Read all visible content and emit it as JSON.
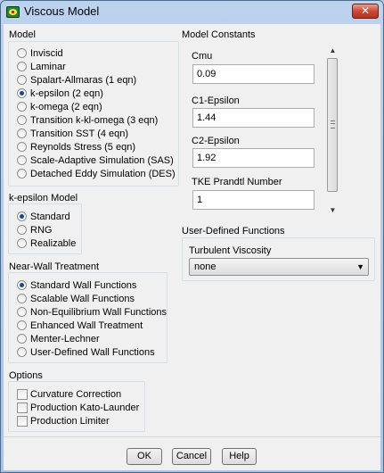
{
  "window": {
    "title": "Viscous Model",
    "close_glyph": "✕"
  },
  "model": {
    "label": "Model",
    "options": [
      {
        "label": "Inviscid",
        "selected": false
      },
      {
        "label": "Laminar",
        "selected": false
      },
      {
        "label": "Spalart-Allmaras (1 eqn)",
        "selected": false
      },
      {
        "label": "k-epsilon (2 eqn)",
        "selected": true
      },
      {
        "label": "k-omega (2 eqn)",
        "selected": false
      },
      {
        "label": "Transition k-kl-omega (3 eqn)",
        "selected": false
      },
      {
        "label": "Transition SST (4 eqn)",
        "selected": false
      },
      {
        "label": "Reynolds Stress (5 eqn)",
        "selected": false
      },
      {
        "label": "Scale-Adaptive Simulation (SAS)",
        "selected": false
      },
      {
        "label": "Detached Eddy Simulation (DES)",
        "selected": false
      }
    ]
  },
  "k_epsilon_model": {
    "label": "k-epsilon Model",
    "options": [
      {
        "label": "Standard",
        "selected": true
      },
      {
        "label": "RNG",
        "selected": false
      },
      {
        "label": "Realizable",
        "selected": false
      }
    ]
  },
  "near_wall": {
    "label": "Near-Wall Treatment",
    "options": [
      {
        "label": "Standard Wall Functions",
        "selected": true
      },
      {
        "label": "Scalable Wall Functions",
        "selected": false
      },
      {
        "label": "Non-Equilibrium Wall Functions",
        "selected": false
      },
      {
        "label": "Enhanced Wall Treatment",
        "selected": false
      },
      {
        "label": "Menter-Lechner",
        "selected": false
      },
      {
        "label": "User-Defined Wall Functions",
        "selected": false
      }
    ]
  },
  "options": {
    "label": "Options",
    "checkboxes": [
      {
        "label": "Curvature Correction",
        "checked": false
      },
      {
        "label": "Production Kato-Launder",
        "checked": false
      },
      {
        "label": "Production Limiter",
        "checked": false
      }
    ]
  },
  "model_constants": {
    "label": "Model Constants",
    "fields": [
      {
        "label": "Cmu",
        "value": "0.09"
      },
      {
        "label": "C1-Epsilon",
        "value": "1.44"
      },
      {
        "label": "C2-Epsilon",
        "value": "1.92"
      },
      {
        "label": "TKE Prandtl Number",
        "value": "1"
      }
    ],
    "scroll_up": "▲",
    "scroll_down": "▼"
  },
  "udf": {
    "label": "User-Defined Functions",
    "turbulent_viscosity_label": "Turbulent Viscosity",
    "turbulent_viscosity_value": "none",
    "dropdown_glyph": "▼"
  },
  "buttons": {
    "ok": "OK",
    "cancel": "Cancel",
    "help": "Help"
  }
}
